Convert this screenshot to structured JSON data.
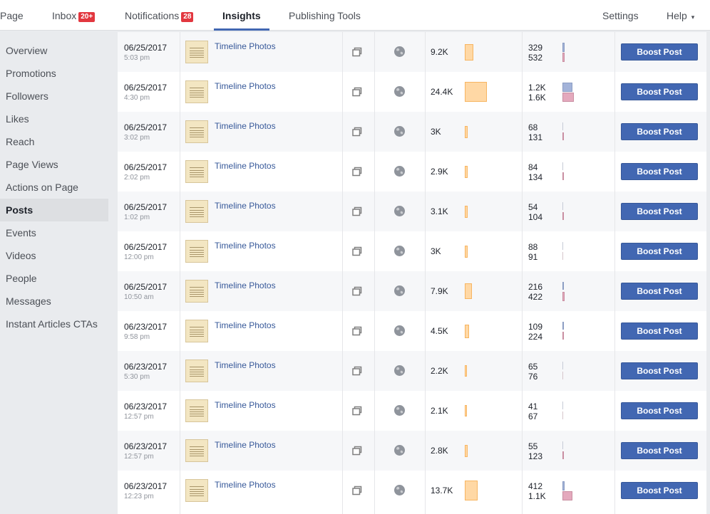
{
  "nav": {
    "page": "Page",
    "inbox": "Inbox",
    "inbox_badge": "20+",
    "notifications": "Notifications",
    "notifications_badge": "28",
    "insights": "Insights",
    "publishing_tools": "Publishing Tools",
    "settings": "Settings",
    "help": "Help",
    "help_caret": "▾"
  },
  "sidebar": {
    "items": [
      {
        "label": "Overview",
        "active": false
      },
      {
        "label": "Promotions",
        "active": false
      },
      {
        "label": "Followers",
        "active": false
      },
      {
        "label": "Likes",
        "active": false
      },
      {
        "label": "Reach",
        "active": false
      },
      {
        "label": "Page Views",
        "active": false
      },
      {
        "label": "Actions on Page",
        "active": false
      },
      {
        "label": "Posts",
        "active": true
      },
      {
        "label": "Events",
        "active": false
      },
      {
        "label": "Videos",
        "active": false
      },
      {
        "label": "People",
        "active": false
      },
      {
        "label": "Messages",
        "active": false
      },
      {
        "label": "Instant Articles CTAs",
        "active": false
      }
    ]
  },
  "colors": {
    "accent": "#4267b2",
    "badge": "#e2373f",
    "reach_bar": "#ffd8a5",
    "engagement_bar_1": "#a3b3d9",
    "engagement_bar_2": "#e4a9bd"
  },
  "icons": {
    "type": "multi-photo-icon",
    "audience": "globe-icon"
  },
  "posts": [
    {
      "date": "06/25/2017",
      "time": "5:03 pm",
      "title": "Timeline Photos",
      "reach": "9.2K",
      "reach_value": 9200,
      "engagement_1": "329",
      "engagement_1_value": 329,
      "engagement_2": "532",
      "engagement_2_value": 532,
      "boost_label": "Boost Post"
    },
    {
      "date": "06/25/2017",
      "time": "4:30 pm",
      "title": "Timeline Photos",
      "reach": "24.4K",
      "reach_value": 24400,
      "engagement_1": "1.2K",
      "engagement_1_value": 1200,
      "engagement_2": "1.6K",
      "engagement_2_value": 1600,
      "boost_label": "Boost Post"
    },
    {
      "date": "06/25/2017",
      "time": "3:02 pm",
      "title": "Timeline Photos",
      "reach": "3K",
      "reach_value": 3000,
      "engagement_1": "68",
      "engagement_1_value": 68,
      "engagement_2": "131",
      "engagement_2_value": 131,
      "boost_label": "Boost Post"
    },
    {
      "date": "06/25/2017",
      "time": "2:02 pm",
      "title": "Timeline Photos",
      "reach": "2.9K",
      "reach_value": 2900,
      "engagement_1": "84",
      "engagement_1_value": 84,
      "engagement_2": "134",
      "engagement_2_value": 134,
      "boost_label": "Boost Post"
    },
    {
      "date": "06/25/2017",
      "time": "1:02 pm",
      "title": "Timeline Photos",
      "reach": "3.1K",
      "reach_value": 3100,
      "engagement_1": "54",
      "engagement_1_value": 54,
      "engagement_2": "104",
      "engagement_2_value": 104,
      "boost_label": "Boost Post"
    },
    {
      "date": "06/25/2017",
      "time": "12:00 pm",
      "title": "Timeline Photos",
      "reach": "3K",
      "reach_value": 3000,
      "engagement_1": "88",
      "engagement_1_value": 88,
      "engagement_2": "91",
      "engagement_2_value": 91,
      "boost_label": "Boost Post"
    },
    {
      "date": "06/25/2017",
      "time": "10:50 am",
      "title": "Timeline Photos",
      "reach": "7.9K",
      "reach_value": 7900,
      "engagement_1": "216",
      "engagement_1_value": 216,
      "engagement_2": "422",
      "engagement_2_value": 422,
      "boost_label": "Boost Post"
    },
    {
      "date": "06/23/2017",
      "time": "9:58 pm",
      "title": "Timeline Photos",
      "reach": "4.5K",
      "reach_value": 4500,
      "engagement_1": "109",
      "engagement_1_value": 109,
      "engagement_2": "224",
      "engagement_2_value": 224,
      "boost_label": "Boost Post"
    },
    {
      "date": "06/23/2017",
      "time": "5:30 pm",
      "title": "Timeline Photos",
      "reach": "2.2K",
      "reach_value": 2200,
      "engagement_1": "65",
      "engagement_1_value": 65,
      "engagement_2": "76",
      "engagement_2_value": 76,
      "boost_label": "Boost Post"
    },
    {
      "date": "06/23/2017",
      "time": "12:57 pm",
      "title": "Timeline Photos",
      "reach": "2.1K",
      "reach_value": 2100,
      "engagement_1": "41",
      "engagement_1_value": 41,
      "engagement_2": "67",
      "engagement_2_value": 67,
      "boost_label": "Boost Post"
    },
    {
      "date": "06/23/2017",
      "time": "12:57 pm",
      "title": "Timeline Photos",
      "reach": "2.8K",
      "reach_value": 2800,
      "engagement_1": "55",
      "engagement_1_value": 55,
      "engagement_2": "123",
      "engagement_2_value": 123,
      "boost_label": "Boost Post"
    },
    {
      "date": "06/23/2017",
      "time": "12:23 pm",
      "title": "Timeline Photos",
      "reach": "13.7K",
      "reach_value": 13700,
      "engagement_1": "412",
      "engagement_1_value": 412,
      "engagement_2": "1.1K",
      "engagement_2_value": 1100,
      "boost_label": "Boost Post"
    }
  ]
}
